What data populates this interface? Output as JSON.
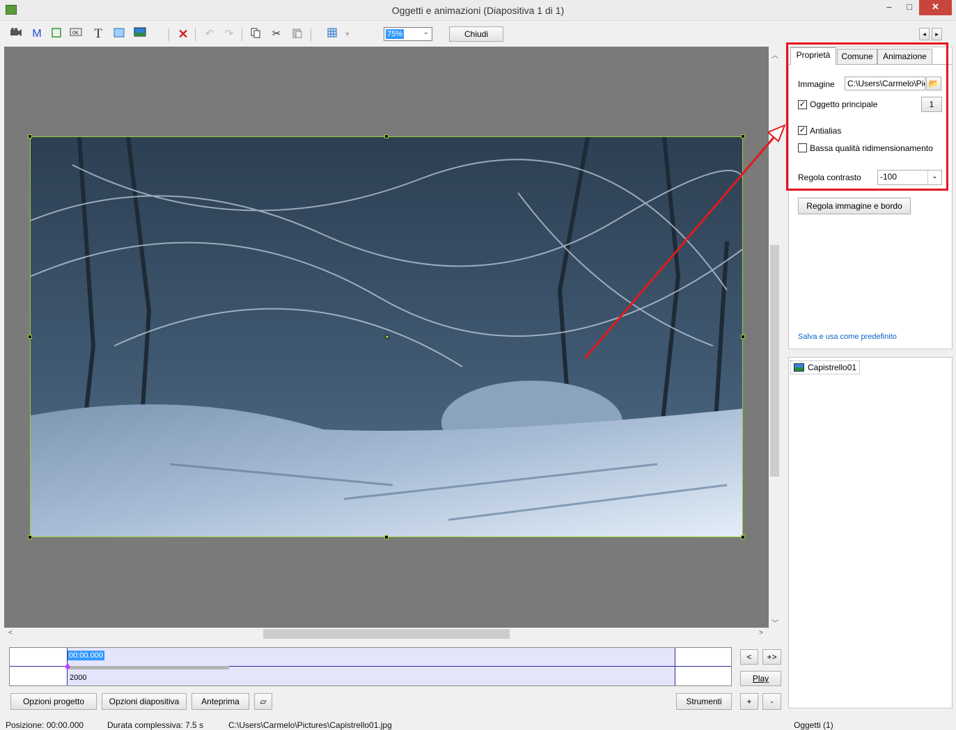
{
  "window": {
    "title": "Oggetti e animazioni  (Diapositiva 1 di 1)",
    "min_label": "–",
    "max_label": "□",
    "close_label": "✕"
  },
  "toolbar": {
    "zoom_value": "75%",
    "close_label": "Chiudi",
    "nav_prev": "◂",
    "nav_next": "▸"
  },
  "properties": {
    "tabs": [
      "Proprietà",
      "Comune",
      "Animazione"
    ],
    "image_label": "Immagine",
    "image_path": "C:\\Users\\Carmelo\\Pictures\\Capistrello01.jpg",
    "main_object_label": "Oggetto principale",
    "main_object_checked": true,
    "main_object_index": "1",
    "antialias_label": "Antialias",
    "antialias_checked": true,
    "low_quality_label": "Bassa qualità ridimensionamento",
    "low_quality_checked": false,
    "contrast_label": "Regola contrasto",
    "contrast_value": "-100",
    "adjust_button": "Regola immagine e bordo",
    "save_default_link": "Salva e usa come predefinito"
  },
  "objects": {
    "items": [
      "Capistrello01"
    ]
  },
  "timeline": {
    "time": "00:00.000",
    "value": "2000",
    "prev": "<",
    "expand": "+>",
    "play": "Play",
    "add": "+",
    "remove": "-"
  },
  "bottom_buttons": {
    "project_options": "Opzioni progetto",
    "slide_options": "Opzioni diapositiva",
    "preview": "Anteprima",
    "tools": "Strumenti"
  },
  "status": {
    "position": "Posizione:  00:00.000",
    "total_duration": "Durata complessiva:  7.5 s",
    "file_path": "C:\\Users\\Carmelo\\Pictures\\Capistrello01.jpg",
    "objects_count": "Oggetti (1)"
  }
}
